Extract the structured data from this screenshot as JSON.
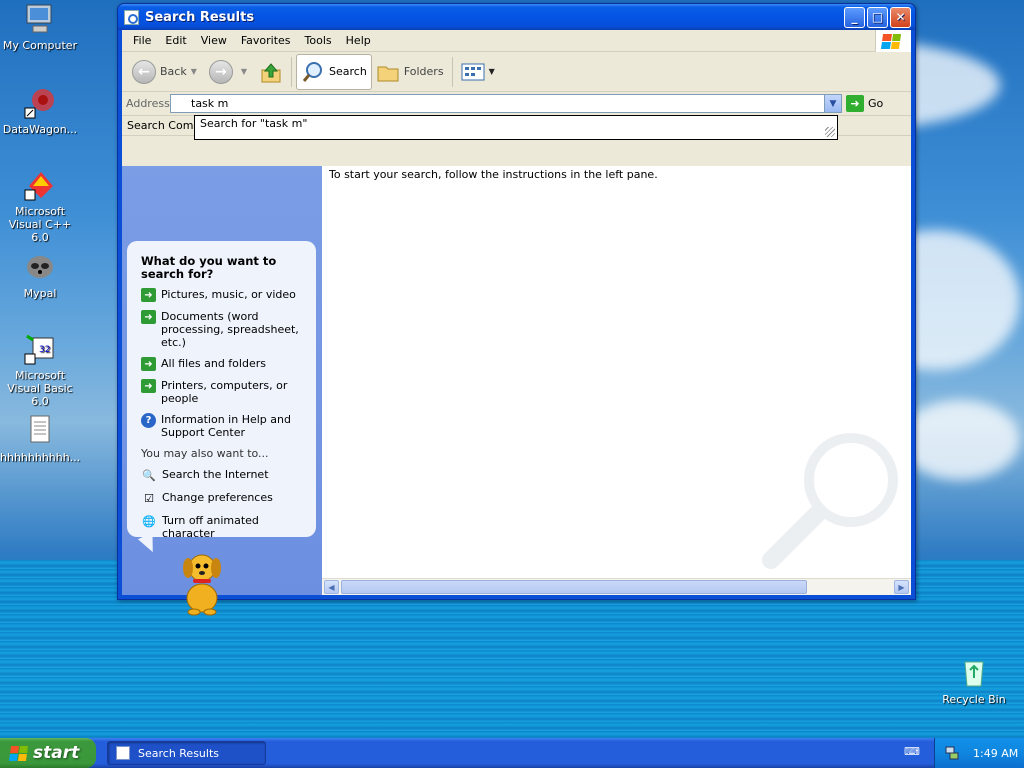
{
  "desktop": {
    "icons": [
      {
        "label": "My Computer",
        "icon": "computer-icon"
      },
      {
        "label": "DataWagon...",
        "icon": "datawagon-icon"
      },
      {
        "label": "Microsoft Visual C++ 6.0",
        "icon": "visual-cpp-icon"
      },
      {
        "label": "Mypal",
        "icon": "mypal-icon"
      },
      {
        "label": "Microsoft Visual Basic 6.0",
        "icon": "visual-basic-icon"
      },
      {
        "label": "hhhhhhhhhh...",
        "icon": "text-file-icon"
      },
      {
        "label": "Recycle Bin",
        "icon": "recycle-bin-icon"
      }
    ]
  },
  "window": {
    "title": "Search Results",
    "menu": [
      "File",
      "Edit",
      "View",
      "Favorites",
      "Tools",
      "Help"
    ],
    "toolbar": {
      "back": "Back",
      "search": "Search",
      "folders": "Folders"
    },
    "address": {
      "label": "Address",
      "value": "task m",
      "go": "Go",
      "suggestion": "Search for \"task m\""
    },
    "column_header": "Search Compa",
    "left_pane": {
      "heading": "What do you want to search for?",
      "options": [
        "Pictures, music, or video",
        "Documents (word processing, spreadsheet, etc.)",
        "All files and folders",
        "Printers, computers, or people",
        "Information in Help and Support Center"
      ],
      "also_heading": "You may also want to...",
      "also_options": [
        "Search the Internet",
        "Change preferences",
        "Turn off animated character"
      ]
    },
    "right_pane": {
      "message": "To start your search, follow the instructions in the left pane."
    }
  },
  "taskbar": {
    "start": "start",
    "task": "Search Results",
    "clock": "1:49 AM"
  },
  "colors": {
    "title_blue": "#0554e4",
    "taskbar_blue": "#245edb",
    "start_green": "#3c983c",
    "pane_blue": "#7b9de6"
  }
}
